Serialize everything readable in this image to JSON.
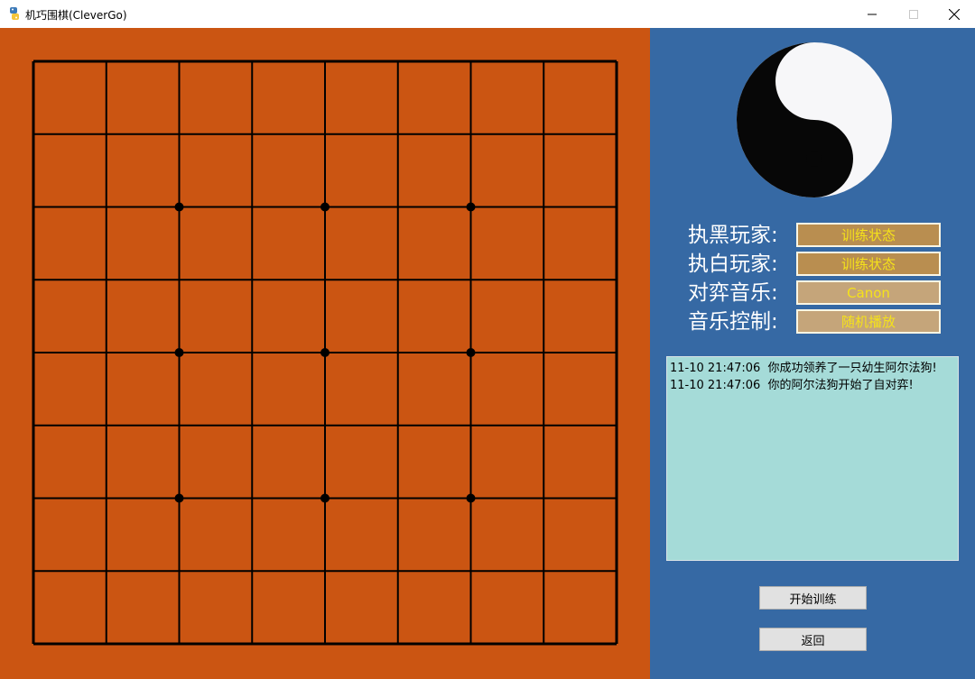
{
  "window": {
    "title": "机巧围棋(CleverGo)"
  },
  "icons": {
    "app": "python-icon",
    "minimize": "minimize-icon",
    "maximize": "maximize-icon",
    "close": "close-icon"
  },
  "board": {
    "size": 9,
    "star_points": [
      [
        2,
        2
      ],
      [
        2,
        4
      ],
      [
        2,
        6
      ],
      [
        4,
        2
      ],
      [
        4,
        4
      ],
      [
        4,
        6
      ],
      [
        6,
        2
      ],
      [
        6,
        4
      ],
      [
        6,
        6
      ]
    ]
  },
  "panel": {
    "rows": [
      {
        "label": "执黑玩家:",
        "value": "训练状态"
      },
      {
        "label": "执白玩家:",
        "value": "训练状态"
      },
      {
        "label": "对弈音乐:",
        "value": "Canon"
      },
      {
        "label": "音乐控制:",
        "value": "随机播放"
      }
    ],
    "log": [
      "11-10 21:47:06  你成功领养了一只幼生阿尔法狗!",
      "11-10 21:47:06  你的阿尔法狗开始了自对弈!"
    ],
    "start_button": "开始训练",
    "back_button": "返回"
  },
  "colors": {
    "board": "#cb5512",
    "panel": "#3669a4",
    "log_bg": "#a5dbd8",
    "field_text": "#f5e21a",
    "field_bg_player": "#b98e50",
    "field_bg_option": "#c5a57a"
  }
}
